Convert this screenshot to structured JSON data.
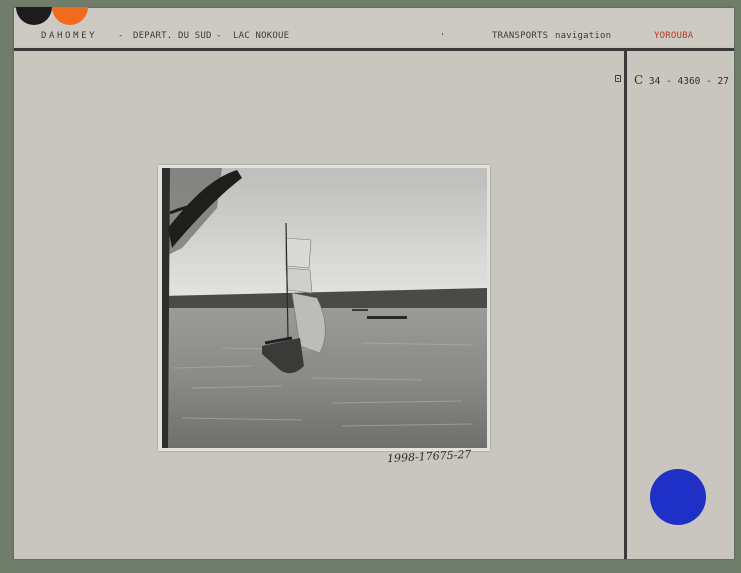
{
  "header": {
    "region": "DAHOMEY",
    "separator_1": "-",
    "department": "DEPART. DU SUD",
    "separator_2": "-",
    "location": "LAC NOKOUE",
    "mark": "'",
    "subject": "TRANSPORTS",
    "category": "navigation",
    "people": "YOROUBA"
  },
  "reference": {
    "prefix": "C",
    "number": "34 - 4360 - 27"
  },
  "photo": {
    "icon": "photograph"
  },
  "inventory_number": "1998-17675-27",
  "colors": {
    "card": "#c9c6c0",
    "people_label": "#c8322a",
    "blue_sticker": "#1f2fc7",
    "orange_dot": "#f26a1b",
    "black_dot": "#1c1c1c"
  }
}
